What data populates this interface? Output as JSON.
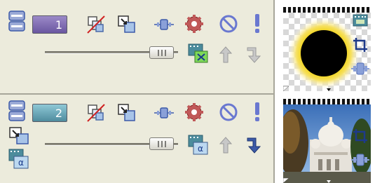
{
  "tracks": [
    {
      "number": "1",
      "number_color": "#7c6aa8",
      "slider_level": 0.85,
      "icons": [
        "track-header-icon",
        "pan-crop-icon",
        "composite-mode-icon",
        "bypass-motion-blur-icon",
        "track-fx-icon",
        "mute-icon",
        "solo-icon",
        "volume-slider",
        "track-motion-icon",
        "make-compositing-parent-icon",
        "make-compositing-child-icon"
      ]
    },
    {
      "number": "2",
      "number_color": "#5d98a8",
      "slider_level": 0.85,
      "icons": [
        "track-header-icon",
        "pan-crop-icon",
        "composite-mode-icon",
        "bypass-motion-blur-icon",
        "track-fx-icon",
        "mute-icon",
        "solo-icon",
        "volume-slider",
        "track-motion-icon",
        "make-compositing-parent-icon",
        "make-compositing-child-icon"
      ]
    }
  ],
  "colors": {
    "panel_bg": "#ecebdc",
    "track1_accent": "#7c6aa8",
    "track2_accent": "#5d98a8",
    "separator": "#a7a69a",
    "icon_blue": "#3c5aa8"
  },
  "timeline": {
    "clip1_icons": [
      "event-fx-icon",
      "crop-icon",
      "pan-icon"
    ],
    "clip2_icons": [
      "crop-icon",
      "pan-icon"
    ]
  }
}
